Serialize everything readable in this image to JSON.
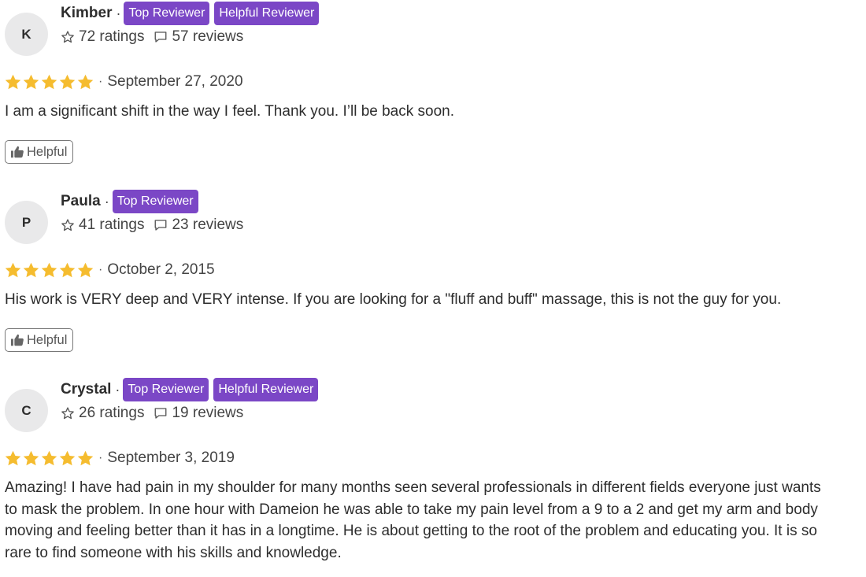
{
  "reviews": [
    {
      "initial": "K",
      "name": "Kimber",
      "separator": "·",
      "badges": [
        "Top Reviewer",
        "Helpful Reviewer"
      ],
      "ratings": "72 ratings",
      "reviews": "57 reviews",
      "stars": 5,
      "date": "September 27, 2020",
      "text": "I am a significant shift in the way I feel. Thank you. I’ll be back soon.",
      "helpful_label": "Helpful"
    },
    {
      "initial": "P",
      "name": "Paula",
      "separator": "·",
      "badges": [
        "Top Reviewer"
      ],
      "ratings": "41 ratings",
      "reviews": "23 reviews",
      "stars": 5,
      "date": "October 2, 2015",
      "text": "His work is VERY deep and VERY intense. If you are looking for a \"fluff and buff\" massage, this is not the guy for you.",
      "helpful_label": "Helpful"
    },
    {
      "initial": "C",
      "name": "Crystal",
      "separator": "·",
      "badges": [
        "Top Reviewer",
        "Helpful Reviewer"
      ],
      "ratings": "26 ratings",
      "reviews": "19 reviews",
      "stars": 5,
      "date": "September 3, 2019",
      "text": "Amazing! I have had pain in my shoulder for many months seen several professionals in different fields everyone just wants to mask the problem. In one hour with Dameion he was able to take my pain level from a 9 to a 2 and get my arm and body moving and feeling better than it has in a longtime. He is about getting to the root of the problem and educating you. It is so rare to find someone with his skills and knowledge.",
      "helpful_label": "Helpful"
    }
  ],
  "colors": {
    "badge": "#7b47c6",
    "star": "#f5bc2f",
    "avatar_bg": "#e9e9ea"
  },
  "icons": {
    "ratings": "star-outline-icon",
    "reviews": "speech-bubble-icon",
    "helpful": "thumbs-up-icon"
  }
}
